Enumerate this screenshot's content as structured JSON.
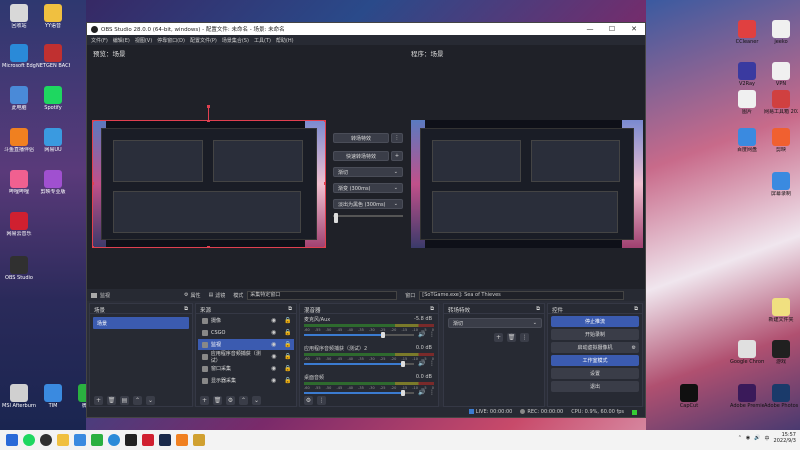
{
  "desktop": {
    "left_icons": [
      {
        "label": "回收站",
        "color": "#d8d8d8"
      },
      {
        "label": "YY语音",
        "color": "#f0c040"
      },
      {
        "label": "Microsoft Edge",
        "color": "#2a8ad8"
      },
      {
        "label": "NETGEN BACH TO...",
        "color": "#c03030"
      },
      {
        "label": "此电脑",
        "color": "#4a8ad8"
      },
      {
        "label": "Spotify",
        "color": "#1ed760"
      },
      {
        "label": "斗鱼直播伴侣",
        "color": "#f08020"
      },
      {
        "label": "网易UU",
        "color": "#3a9ae0"
      },
      {
        "label": "哔哩哔哩",
        "color": "#f06090"
      },
      {
        "label": "剪映专业版",
        "color": "#a050d0"
      },
      {
        "label": "网易云音乐",
        "color": "#d02030"
      },
      {
        "label": "OBS Studio",
        "color": "#303030"
      },
      {
        "label": "MSI Afterburner",
        "color": "#d0d0d0"
      },
      {
        "label": "TIM",
        "color": "#3a8ae0"
      },
      {
        "label": "微信",
        "color": "#2ab040"
      }
    ],
    "right_icons": [
      {
        "label": "CCleaner"
      },
      {
        "label": "jeeko"
      },
      {
        "label": "V2Ray"
      },
      {
        "label": "VPN"
      },
      {
        "label": "图片"
      },
      {
        "label": "网易工具箱 2022"
      },
      {
        "label": "百度网盘"
      },
      {
        "label": "剪映"
      },
      {
        "label": "屏幕录制"
      },
      {
        "label": "新建文件夹"
      },
      {
        "label": "Google Chrome"
      },
      {
        "label": "游戏"
      },
      {
        "label": "CapCut"
      },
      {
        "label": "Adobe Premiere"
      },
      {
        "label": "Adobe Photoshop"
      }
    ]
  },
  "window": {
    "title": "OBS Studio 28.0.0 (64-bit, windows) - 配置文件: 未命名 - 场景: 未命名",
    "minimize": "—",
    "maximize": "☐",
    "close": "✕",
    "menu": [
      "文件(F)",
      "编辑(E)",
      "视图(V)",
      "停靠窗口(D)",
      "配置文件(P)",
      "场景集合(S)",
      "工具(T)",
      "帮助(H)"
    ]
  },
  "studio": {
    "preview_label": "预览：场景",
    "program_label": "程序：场景",
    "transition_button": "转场特效",
    "quick_transition": "快速转场特效",
    "transition_select": "渐切",
    "duration_select": "渐变 (300ms)",
    "transition_select_2": "淡出为黑色 (300ms)",
    "more_icon": "⋮",
    "add_icon": "+",
    "chevron": "⌄"
  },
  "source_toolbar": {
    "selected_source": "监视",
    "properties": "属性",
    "filters": "滤镜",
    "mode_label": "模式",
    "mode_value": "采集特定窗口",
    "window_label": "窗口",
    "window_value": "[SoTGame.exe]: Sea of Thieves"
  },
  "scenes": {
    "title": "场景",
    "items": [
      "场景"
    ]
  },
  "sources": {
    "title": "来源",
    "items": [
      {
        "label": "摄像",
        "selected": false
      },
      {
        "label": "CSGO",
        "selected": false
      },
      {
        "label": "监视",
        "selected": true
      },
      {
        "label": "应用程序音频捕获（测试）",
        "selected": false
      },
      {
        "label": "窗口采集",
        "selected": false
      },
      {
        "label": "显示器采集",
        "selected": false
      }
    ]
  },
  "mixer": {
    "title": "混音器",
    "channels": [
      {
        "name": "麦克风/Aux",
        "db": "-5.8 dB",
        "level": 0.72
      },
      {
        "name": "应用程序音频捕获（测试）2",
        "db": "0.0 dB",
        "level": 0.9
      },
      {
        "name": "桌面音频",
        "db": "0.0 dB",
        "level": 0.9
      }
    ],
    "ticks": [
      "-60",
      "-55",
      "-50",
      "-45",
      "-40",
      "-35",
      "-30",
      "-25",
      "-20",
      "-15",
      "-10",
      "-5",
      "0"
    ]
  },
  "transitions_dock": {
    "title": "转场特效",
    "value": "渐切"
  },
  "controls": {
    "title": "控件",
    "stop_stream": "停止推流",
    "start_record": "开始录制",
    "virtual_cam": "启动虚拟摄像机",
    "studio_mode": "工作室模式",
    "settings": "设置",
    "exit": "退出"
  },
  "status": {
    "live": "LIVE: 00:00:00",
    "rec": "REC: 00:00:00",
    "cpu": "CPU: 0.9%, 60.00 fps"
  },
  "taskbar": {
    "time": "15:57",
    "date": "2022/9/3",
    "lang": "中"
  }
}
